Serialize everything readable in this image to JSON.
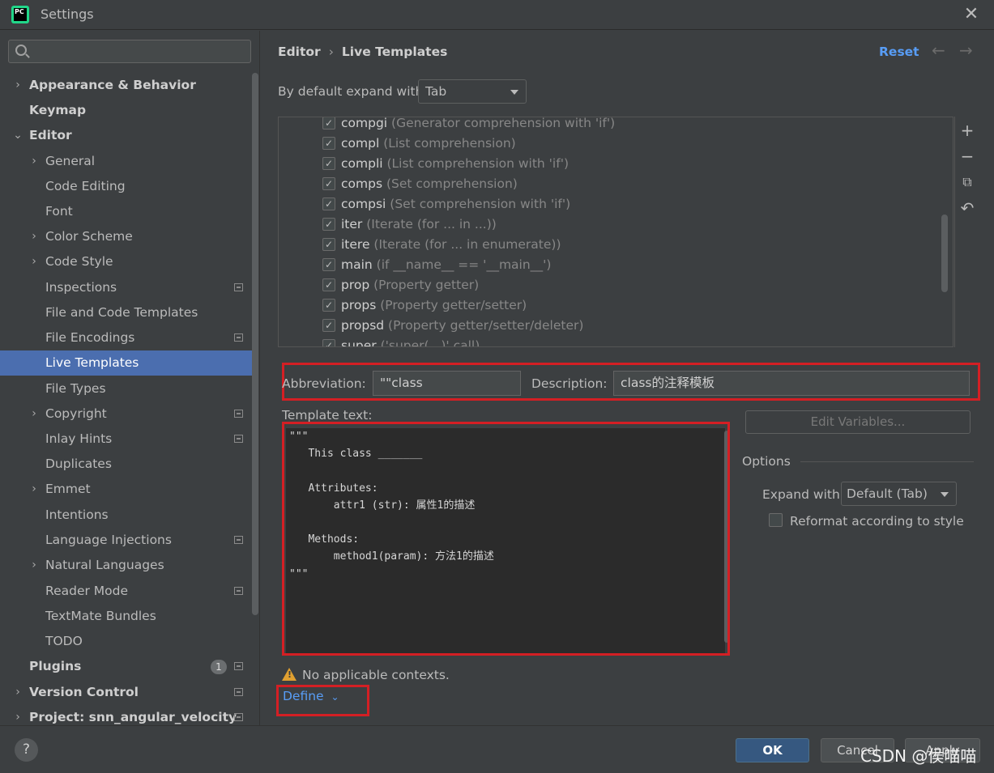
{
  "window": {
    "title": "Settings",
    "close_icon": "✕"
  },
  "search": {
    "placeholder": ""
  },
  "sidebar": {
    "items": [
      {
        "label": "Appearance & Behavior",
        "arrow": "›"
      },
      {
        "label": "Keymap"
      },
      {
        "label": "Editor",
        "arrow": "⌄"
      },
      {
        "label": "General",
        "arrow": "›"
      },
      {
        "label": "Code Editing"
      },
      {
        "label": "Font"
      },
      {
        "label": "Color Scheme",
        "arrow": "›"
      },
      {
        "label": "Code Style",
        "arrow": "›"
      },
      {
        "label": "Inspections"
      },
      {
        "label": "File and Code Templates"
      },
      {
        "label": "File Encodings"
      },
      {
        "label": "Live Templates"
      },
      {
        "label": "File Types"
      },
      {
        "label": "Copyright",
        "arrow": "›"
      },
      {
        "label": "Inlay Hints"
      },
      {
        "label": "Duplicates"
      },
      {
        "label": "Emmet",
        "arrow": "›"
      },
      {
        "label": "Intentions"
      },
      {
        "label": "Language Injections"
      },
      {
        "label": "Natural Languages",
        "arrow": "›"
      },
      {
        "label": "Reader Mode"
      },
      {
        "label": "TextMate Bundles"
      },
      {
        "label": "TODO"
      },
      {
        "label": "Plugins",
        "badge": "1"
      },
      {
        "label": "Version Control",
        "arrow": "›"
      },
      {
        "label": "Project: snn_angular_velocity",
        "arrow": "›"
      }
    ]
  },
  "breadcrumb": {
    "parent": "Editor",
    "separator": "›",
    "current": "Live Templates"
  },
  "header": {
    "reset": "Reset",
    "back": "←",
    "forward": "→"
  },
  "expand": {
    "label": "By default expand with",
    "value": "Tab"
  },
  "templates": [
    {
      "abbr": "compgi",
      "desc": "(Generator comprehension with 'if')"
    },
    {
      "abbr": "compl",
      "desc": "(List comprehension)"
    },
    {
      "abbr": "compli",
      "desc": "(List comprehension with 'if')"
    },
    {
      "abbr": "comps",
      "desc": "(Set comprehension)"
    },
    {
      "abbr": "compsi",
      "desc": "(Set comprehension with 'if')"
    },
    {
      "abbr": "iter",
      "desc": "(Iterate (for ... in ...))"
    },
    {
      "abbr": "itere",
      "desc": "(Iterate (for ... in enumerate))"
    },
    {
      "abbr": "main",
      "desc": "(if __name__ == '__main__')"
    },
    {
      "abbr": "prop",
      "desc": "(Property getter)"
    },
    {
      "abbr": "props",
      "desc": "(Property getter/setter)"
    },
    {
      "abbr": "propsd",
      "desc": "(Property getter/setter/deleter)"
    },
    {
      "abbr": "super",
      "desc": "('super(...)' call)"
    }
  ],
  "toolbar": {
    "add": "+",
    "remove": "−",
    "copy": "⧉",
    "restore": "↶"
  },
  "form": {
    "abbr_label": "Abbreviation:",
    "abbr_value": "\"\"class",
    "desc_label": "Description:",
    "desc_value": "class的注释模板",
    "template_label": "Template text:",
    "template_text": "\"\"\"\n   This class _______\n\n   Attributes:\n       attr1 (str): 属性1的描述\n\n   Methods:\n       method1(param): 方法1的描述\n\"\"\""
  },
  "options": {
    "edit_variables": "Edit Variables...",
    "title": "Options",
    "expand_label": "Expand with",
    "expand_value": "Default (Tab)",
    "reformat_label": "Reformat according to style"
  },
  "context": {
    "warning": "No applicable contexts.",
    "define": "Define"
  },
  "footer": {
    "help": "?",
    "ok": "OK",
    "cancel": "Cancel",
    "apply": "Apply"
  },
  "watermark": "CSDN @侯喵喵",
  "colors": {
    "accent": "#589df6",
    "selection": "#4b6eaf",
    "highlight_box": "#d41f24"
  }
}
